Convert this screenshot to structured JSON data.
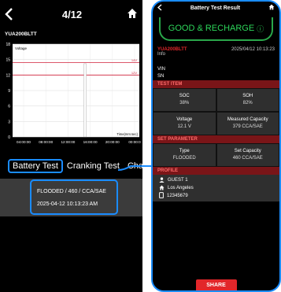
{
  "left": {
    "title": "4/12",
    "device": "YUA200BLTT",
    "chart_data": {
      "type": "line",
      "ylabel": "Voltage",
      "xlabel": "Time(mm:sec)",
      "y_ticks": [
        "18",
        "15",
        "12",
        "9",
        "6",
        "3",
        "0"
      ],
      "x_ticks": [
        "04:00:00",
        "08:00:00",
        "12:00:00",
        "16:00:00",
        "20:00:00",
        "00:00:0"
      ],
      "thresholds": [
        {
          "label": "14V",
          "value": 14.4
        },
        {
          "label": "12V",
          "value": 12.0
        }
      ],
      "series": [
        {
          "color": "#ffffff",
          "values": [
            0,
            0,
            0,
            14.2,
            0,
            0
          ]
        }
      ],
      "ylim": [
        0,
        18
      ]
    },
    "tabs": [
      "Battery Test",
      "Cranking Test",
      "Charging"
    ],
    "detail": {
      "line1": "FLOODED / 460 / CCA/SAE",
      "line2": "2025-04-12 10:13:23 AM"
    }
  },
  "right": {
    "title": "Battery Test Result",
    "result": "GOOD & RECHARGE",
    "device": "YUA200BLTT",
    "datetime": "2025/04/12 10:13:23",
    "info_label": "Info",
    "vin_label": "VIN",
    "sn_label": "SN",
    "test_item_label": "TEST ITEM",
    "soc_label": "SOC",
    "soc_value": "38%",
    "soh_label": "SOH",
    "soh_value": "82%",
    "voltage_label": "Voltage",
    "voltage_value": "12.1 V",
    "capacity_label": "Measured Capacity",
    "capacity_value": "379 CCA/SAE",
    "set_param_label": "SET PARAMETER",
    "type_label": "Type",
    "type_value": "FLOODED",
    "set_cap_label": "Set Capacity",
    "set_cap_value": "460 CCA/SAE",
    "profile_label": "PROFILE",
    "profile_name": "GUEST 1",
    "profile_location": "Los Angeles",
    "profile_phone": "12345679",
    "share_label": "SHARE"
  },
  "colors": {
    "accent_blue": "#1a8cff",
    "good_green": "#2dd65a",
    "red": "#e2262a"
  },
  "icons": [
    "back-icon",
    "home-icon",
    "info-icon",
    "user-icon",
    "house-icon",
    "phone-icon"
  ]
}
